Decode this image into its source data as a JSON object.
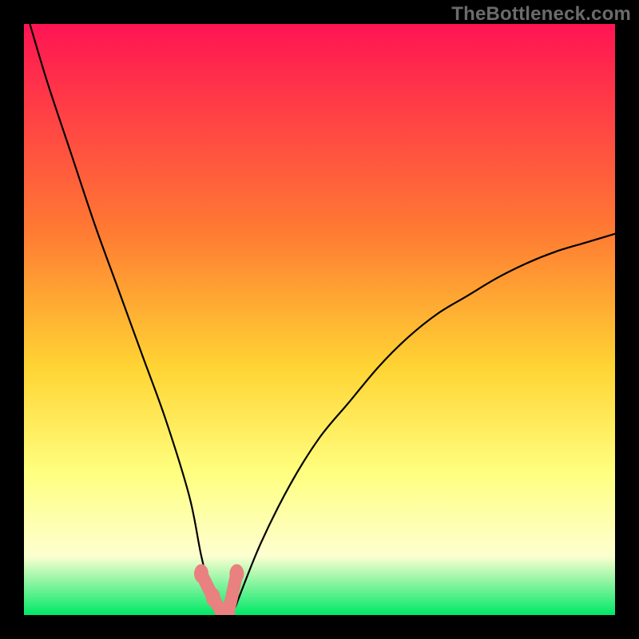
{
  "watermark": "TheBottleneck.com",
  "chart_data": {
    "type": "line",
    "title": "",
    "xlabel": "",
    "ylabel": "",
    "xlim": [
      0,
      100
    ],
    "ylim": [
      0,
      100
    ],
    "note": "Bottleneck curve: y is bottleneck % (0 at optimum). Minimum lies around x≈32–36. Left branch rises steeply toward 100, right branch rises asymptotically toward ~65.",
    "series": [
      {
        "name": "left-branch",
        "x": [
          1,
          4,
          8,
          12,
          16,
          20,
          24,
          28,
          30,
          32
        ],
        "values": [
          100,
          90,
          78,
          66,
          55,
          44,
          33,
          20,
          10,
          2
        ]
      },
      {
        "name": "floor",
        "x": [
          32,
          33,
          34,
          35,
          36
        ],
        "values": [
          2,
          0,
          0,
          0,
          2
        ]
      },
      {
        "name": "right-branch",
        "x": [
          36,
          40,
          45,
          50,
          55,
          60,
          65,
          70,
          75,
          80,
          85,
          90,
          95,
          100
        ],
        "values": [
          2,
          12,
          22,
          30,
          36,
          42,
          47,
          51,
          54,
          57,
          59.5,
          61.5,
          63,
          64.5
        ]
      },
      {
        "name": "markers",
        "x": [
          30,
          32,
          33.5,
          34.5,
          36
        ],
        "values": [
          7,
          3,
          0.5,
          0.5,
          7
        ]
      }
    ],
    "colors": {
      "curve": "#000000",
      "marker": "#e8817f",
      "background_top": "#ff1453",
      "background_mid1": "#ff7a33",
      "background_mid2": "#ffd433",
      "background_mid3": "#ffff80",
      "background_mid4": "#fdffd0",
      "background_bottom": "#00e868"
    }
  }
}
